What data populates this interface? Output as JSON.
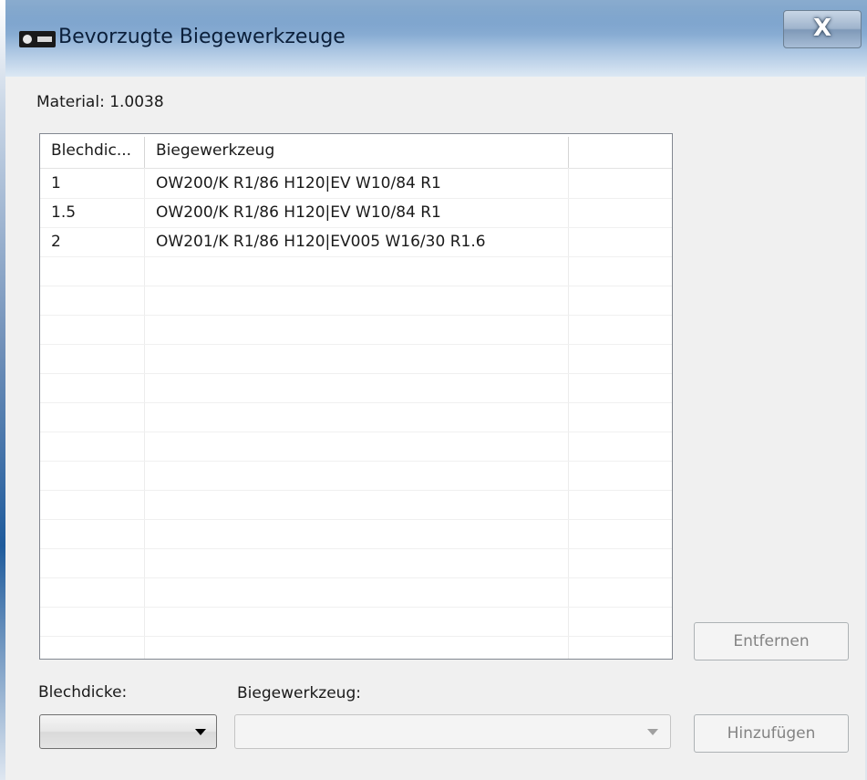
{
  "window": {
    "title": "Bevorzugte Biegewerkzeuge",
    "close_label": "X"
  },
  "material": {
    "label": "Material: 1.0038"
  },
  "table": {
    "columns": [
      "Blechdic...",
      "Biegewerkzeug"
    ],
    "rows": [
      {
        "dicke": "1",
        "werkzeug": "OW200/K R1/86 H120|EV W10/84 R1"
      },
      {
        "dicke": "1.5",
        "werkzeug": "OW200/K R1/86 H120|EV W10/84 R1"
      },
      {
        "dicke": "2",
        "werkzeug": "OW201/K R1/86 H120|EV005 W16/30 R1.6"
      }
    ]
  },
  "buttons": {
    "remove": "Entfernen",
    "add": "Hinzufügen"
  },
  "inputs": {
    "blechdicke_label": "Blechdicke:",
    "blechdicke_value": "",
    "biegewerkzeug_label": "Biegewerkzeug:",
    "biegewerkzeug_value": ""
  },
  "icons": {
    "app": "app-logo-icon",
    "close": "close-icon",
    "dropdown": "chevron-down-icon"
  }
}
